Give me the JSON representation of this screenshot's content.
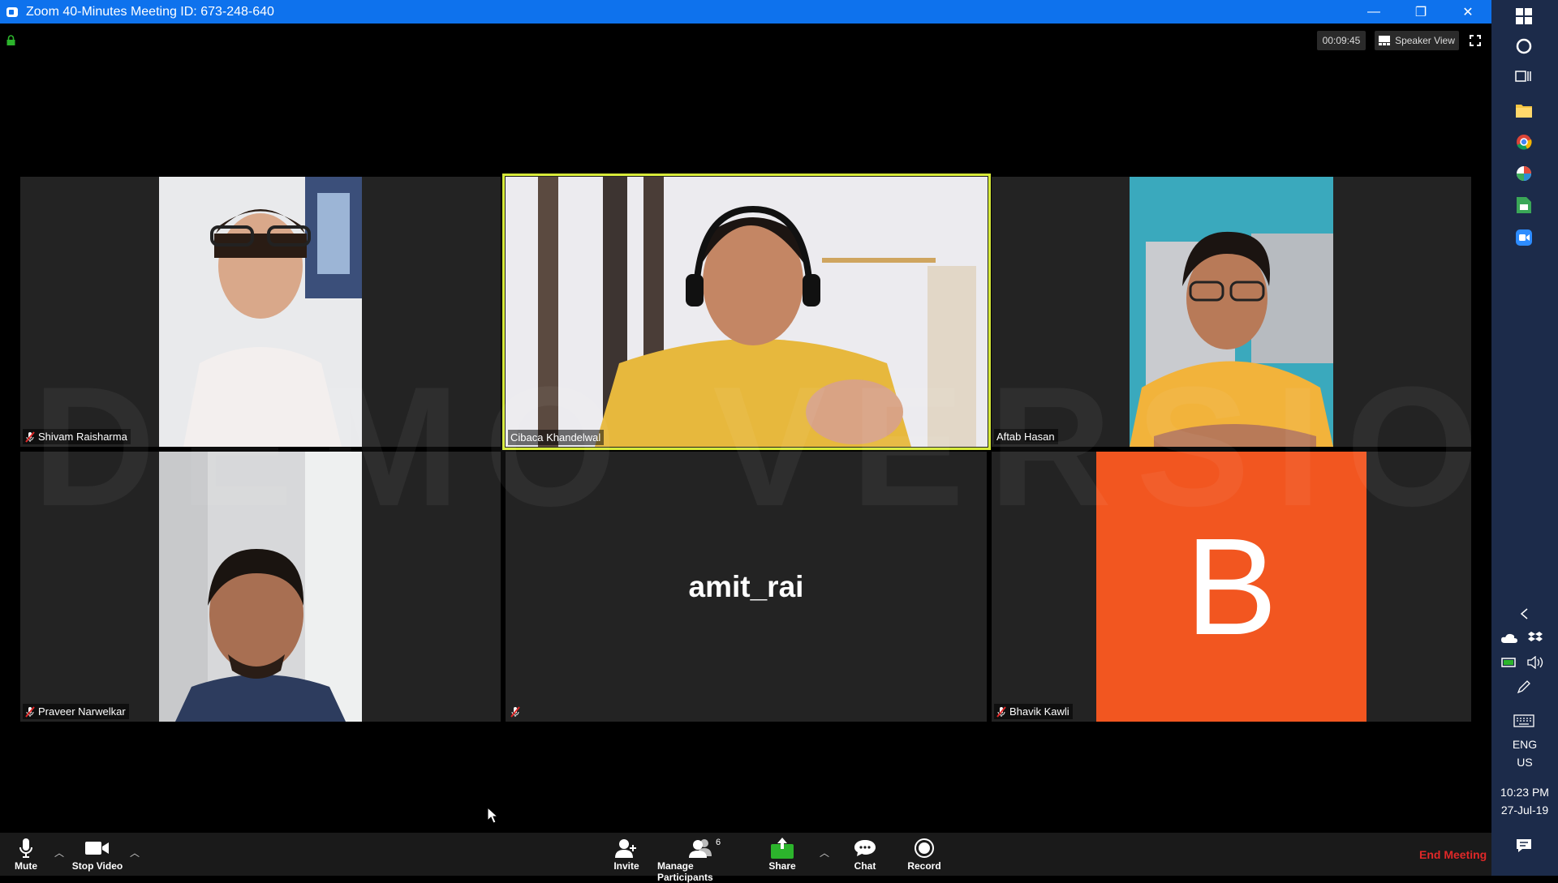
{
  "window": {
    "title": "Zoom 40-Minutes Meeting ID: 673-248-640",
    "minimize": "—",
    "restore": "❐",
    "close": "✕"
  },
  "top": {
    "timer": "00:09:45",
    "view_mode": "Speaker View"
  },
  "watermark": "DEMO VERSION",
  "participants": [
    {
      "name": "Shivam Raisharma",
      "muted": true,
      "type": "video"
    },
    {
      "name": "Cibaca Khandelwal",
      "muted": false,
      "type": "video",
      "active_speaker": true
    },
    {
      "name": "Aftab Hasan",
      "muted": false,
      "type": "video"
    },
    {
      "name": "Praveer Narwelkar",
      "muted": true,
      "type": "video"
    },
    {
      "name": "",
      "display_name": "amit_rai",
      "muted": true,
      "type": "name-only"
    },
    {
      "name": "Bhavik Kawli",
      "muted": true,
      "type": "avatar",
      "avatar_letter": "B",
      "avatar_color": "#f25620"
    }
  ],
  "toolbar": {
    "mute": "Mute",
    "stop_video": "Stop Video",
    "invite": "Invite",
    "manage_participants": "Manage Participants",
    "participant_count": "6",
    "share": "Share",
    "chat": "Chat",
    "record": "Record",
    "end_meeting": "End Meeting"
  },
  "colors": {
    "titlebar": "#0e72ed",
    "active_border": "#d7ea3a",
    "share_green": "#2cb42c",
    "end_red": "#e02828",
    "taskbar": "#1c2b4a"
  },
  "taskbar": {
    "icons": [
      "windows-start-icon",
      "cortana-icon",
      "task-view-icon",
      "file-explorer-icon",
      "chrome-icon",
      "app-icon",
      "sheets-icon",
      "zoom-icon"
    ],
    "lang_line1": "ENG",
    "lang_line2": "US",
    "time": "10:23 PM",
    "date": "27-Jul-19"
  }
}
